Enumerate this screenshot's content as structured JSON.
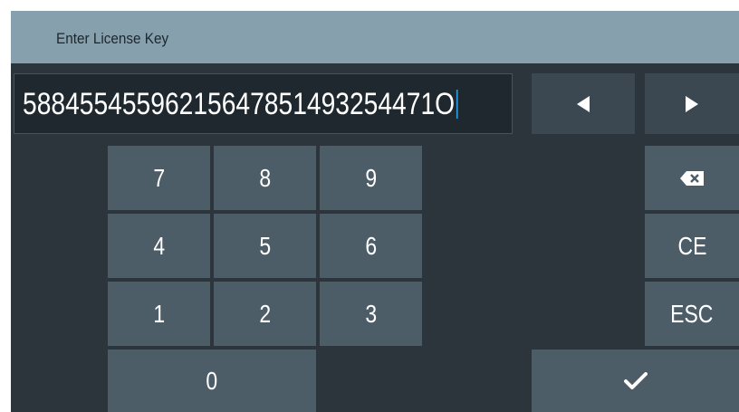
{
  "dialog": {
    "title": "Enter License Key"
  },
  "entry": {
    "value": "58845545596215647851493254471O"
  },
  "keypad": {
    "k7": "7",
    "k8": "8",
    "k9": "9",
    "k4": "4",
    "k5": "5",
    "k6": "6",
    "k1": "1",
    "k2": "2",
    "k3": "3",
    "k0": "0"
  },
  "side_keys": {
    "clear_entry": "CE",
    "escape": "ESC"
  },
  "icons": {
    "cursor_left": "left-triangle-icon",
    "cursor_right": "right-triangle-icon",
    "backspace": "backspace-icon",
    "enter": "checkmark-icon"
  },
  "colors": {
    "titlebar": "#87a0ad",
    "background": "#2c353c",
    "key": "#4c5d68",
    "key_dark": "#3b4852",
    "caret": "#2d9de0"
  }
}
